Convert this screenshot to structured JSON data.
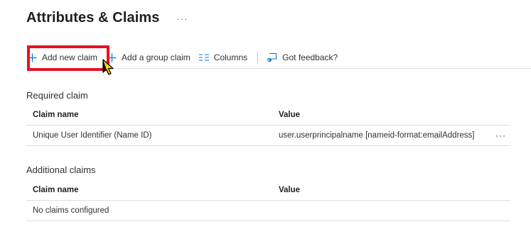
{
  "header": {
    "title": "Attributes & Claims",
    "more": "···"
  },
  "toolbar": {
    "add_new_claim": "Add new claim",
    "add_group_claim": "Add a group claim",
    "columns": "Columns",
    "got_feedback": "Got feedback?",
    "accent_color": "#0078d4"
  },
  "required": {
    "title": "Required claim",
    "headers": {
      "claim_name": "Claim name",
      "value": "Value"
    },
    "rows": [
      {
        "claim_name": "Unique User Identifier (Name ID)",
        "value": "user.userprincipalname [nameid-format:emailAddress]",
        "more": "···"
      }
    ]
  },
  "additional": {
    "title": "Additional claims",
    "headers": {
      "claim_name": "Claim name",
      "value": "Value"
    },
    "empty": "No claims configured"
  },
  "annotation": {
    "highlight_color": "#e81123"
  }
}
